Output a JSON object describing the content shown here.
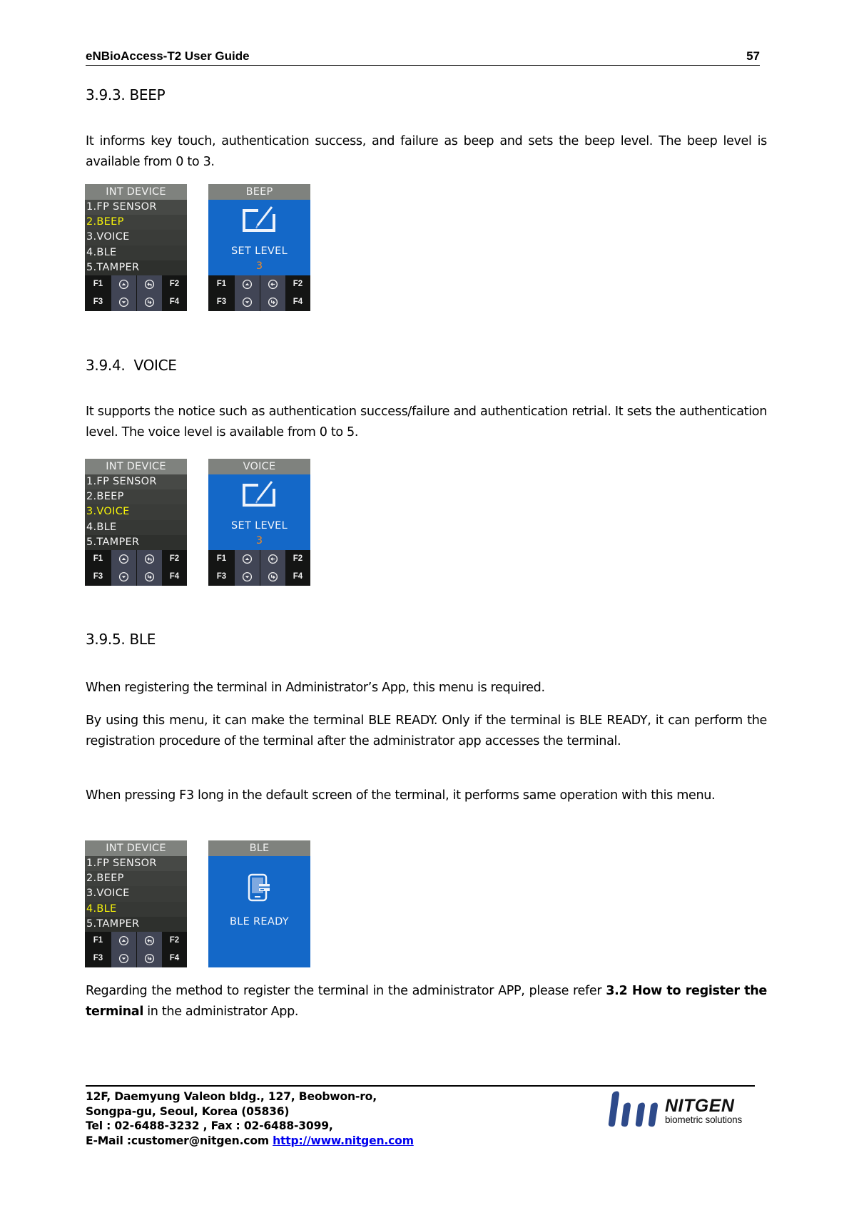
{
  "header": {
    "title": "eNBioAccess-T2 User Guide",
    "page_number": "57"
  },
  "sections": [
    {
      "heading": "3.9.3. BEEP",
      "paragraphs": [
        "It informs key touch, authentication success, and failure as beep and sets the beep level. The beep level is available from 0 to 3."
      ],
      "menu_screen": {
        "title": "INT DEVICE",
        "items": [
          "1.FP SENSOR",
          "2.BEEP",
          "3.VOICE",
          "4.BLE",
          "5.TAMPER"
        ],
        "selected_index": 1
      },
      "detail_screen": {
        "title": "BEEP",
        "icon": "edit-icon",
        "label": "SET LEVEL",
        "value": "3"
      }
    },
    {
      "heading": "3.9.4.  VOICE",
      "paragraphs": [
        "It supports the notice such as authentication success/failure and authentication retrial. It sets the authentication level. The voice level is available from 0 to 5."
      ],
      "menu_screen": {
        "title": "INT DEVICE",
        "items": [
          "1.FP SENSOR",
          "2.BEEP",
          "3.VOICE",
          "4.BLE",
          "5.TAMPER"
        ],
        "selected_index": 2
      },
      "detail_screen": {
        "title": "VOICE",
        "icon": "edit-icon",
        "label": "SET LEVEL",
        "value": "3"
      }
    },
    {
      "heading": "3.9.5. BLE",
      "paragraphs": [
        "When registering the terminal in Administrator’s App, this menu is required.",
        "By using this menu, it can make the terminal BLE READY. Only if the terminal is BLE READY, it can perform the registration procedure of the terminal after the administrator app accesses the terminal.",
        "When pressing F3 long in the default screen of the terminal, it performs same operation with this menu."
      ],
      "menu_screen": {
        "title": "INT DEVICE",
        "items": [
          "1.FP SENSOR",
          "2.BEEP",
          "3.VOICE",
          "4.BLE",
          "5.TAMPER"
        ],
        "selected_index": 3
      },
      "detail_screen": {
        "title": "BLE",
        "icon": "phone-card-icon",
        "label": "BLE READY"
      },
      "closing": {
        "prefix": "Regarding the method to register the terminal in the administrator APP, please refer ",
        "bold": "3.2 How to register the terminal",
        "suffix": " in the administrator App."
      }
    }
  ],
  "keypad": {
    "top_row": [
      "F1",
      "up-icon",
      "back-icon",
      "F2"
    ],
    "bottom_row": [
      "F3",
      "down-icon",
      "enter-icon",
      "F4"
    ],
    "detail_top_row": [
      "F1",
      "up-icon",
      "left-icon",
      "F2"
    ]
  },
  "footer": {
    "address_line1": "12F, Daemyung Valeon bldg., 127, Beobwon-ro,",
    "address_line2": "Songpa-gu, Seoul, Korea (05836)",
    "phone_line": "Tel : 02-6488-3232 , Fax : 02-6488-3099,",
    "email_label": "E-Mail :customer@nitgen.com ",
    "website": "http://www.nitgen.com",
    "logo_name": "NITGEN",
    "logo_tagline": "biometric solutions"
  },
  "colors": {
    "screen_blue": "#1468c8",
    "screen_title_gray": "#7f827e",
    "selected_yellow": "#f5f20a",
    "level_orange": "#f08a24",
    "logo_blue": "#2e4a8a",
    "link_blue": "#0000ee"
  }
}
